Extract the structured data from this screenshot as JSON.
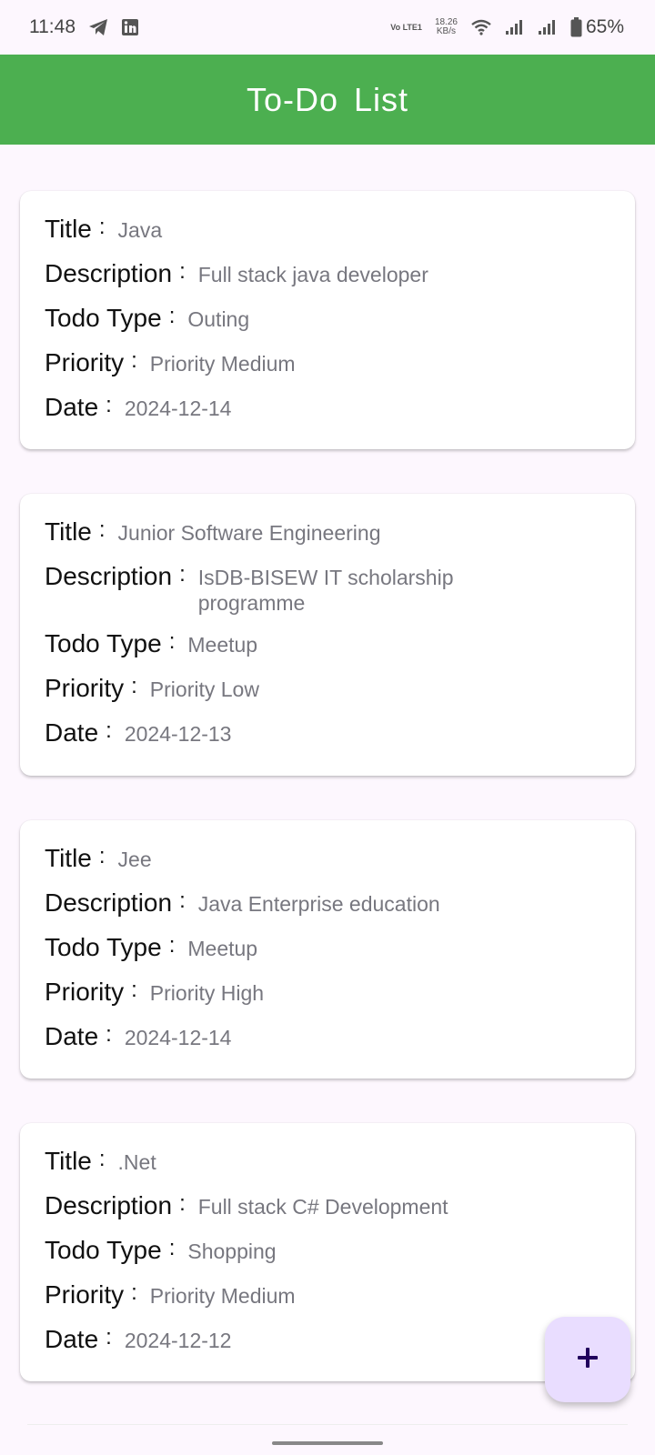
{
  "status_bar": {
    "time": "11:48",
    "volte": "Vo LTE1",
    "net_speed_value": "18.26",
    "net_speed_unit": "KB/s",
    "battery": "65%",
    "icons": [
      "telegram-icon",
      "linkedin-icon",
      "wifi-icon",
      "signal-icon",
      "signal-icon",
      "battery-icon"
    ]
  },
  "app_bar": {
    "title": "To-Do  List",
    "color": "#4caf50"
  },
  "labels": {
    "title": "Title",
    "description": "Description",
    "todo_type": "Todo Type",
    "priority": "Priority",
    "date": "Date",
    "colon": ":"
  },
  "todos": [
    {
      "title": "Java",
      "description": "Full stack java developer",
      "todo_type": "Outing",
      "priority": "Priority Medium",
      "date": "2024-12-14"
    },
    {
      "title": "Junior Software Engineering",
      "description": "IsDB-BISEW IT scholarship programme",
      "todo_type": "Meetup",
      "priority": "Priority Low",
      "date": "2024-12-13"
    },
    {
      "title": "Jee",
      "description": "Java Enterprise education",
      "todo_type": "Meetup",
      "priority": "Priority High",
      "date": "2024-12-14"
    },
    {
      "title": ".Net",
      "description": "Full stack C# Development",
      "todo_type": "Shopping",
      "priority": "Priority Medium",
      "date": "2024-12-12"
    }
  ],
  "fab": {
    "icon": "plus-icon",
    "color": "#e9ddff"
  }
}
